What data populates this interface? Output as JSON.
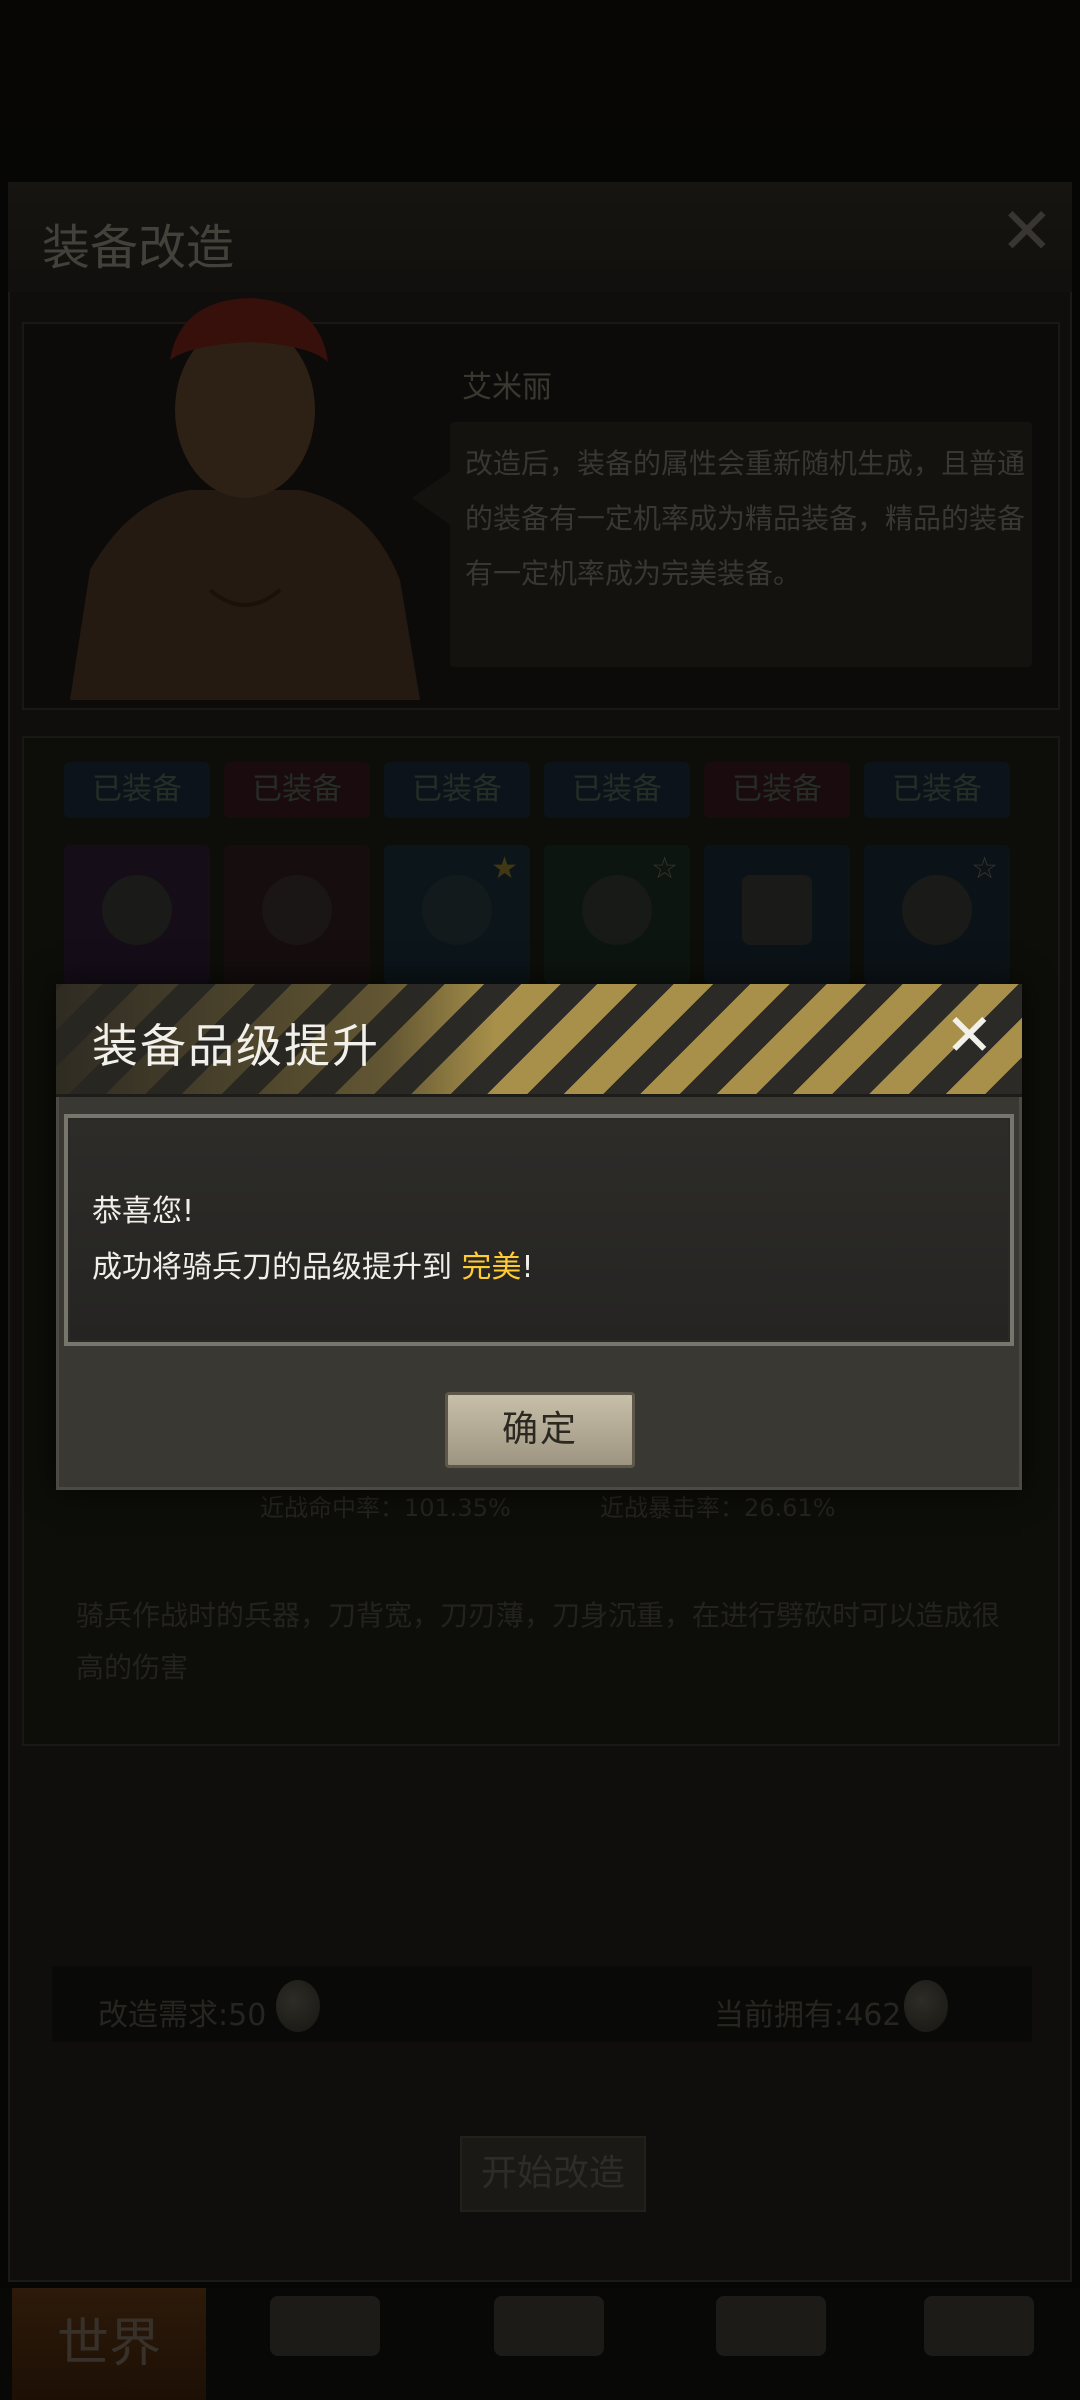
{
  "panel": {
    "title": "装备改造",
    "close_glyph": "✕"
  },
  "npc": {
    "name": "艾米丽",
    "dialog": "改造后，装备的属性会重新随机生成，且普通的装备有一定机率成为精品装备，精品的装备有一定机率成为完美装备。"
  },
  "equipment": {
    "tags": [
      "已装备",
      "已装备",
      "已装备",
      "已装备",
      "已装备",
      "已装备"
    ],
    "slot_icons": [
      "helmet-icon",
      "bow-icon",
      "bow-icon",
      "shotgun-icon",
      "shield-icon",
      "round-shield-icon"
    ]
  },
  "stats": {
    "hit_rate": "近战命中率：101.35%",
    "crit_rate": "近战暴击率：26.61%"
  },
  "item_description": "骑兵作战时的兵器，刀背宽，刀刃薄，刀身沉重，在进行劈砍时可以造成很高的伤害",
  "cost": {
    "required": "改造需求:50",
    "owned": "当前拥有:462"
  },
  "start_button": "开始改造",
  "bottom_nav": {
    "world": "世界"
  },
  "modal": {
    "title": "装备品级提升",
    "close_glyph": "✕",
    "line1": "恭喜您!",
    "line2_prefix": "成功将骑兵刀的品级提升到 ",
    "quality": "完美",
    "line2_suffix": "!",
    "confirm": "确定"
  },
  "colors": {
    "quality_perfect": "#ffcc33",
    "hazard_stripe": "#a8904a"
  }
}
